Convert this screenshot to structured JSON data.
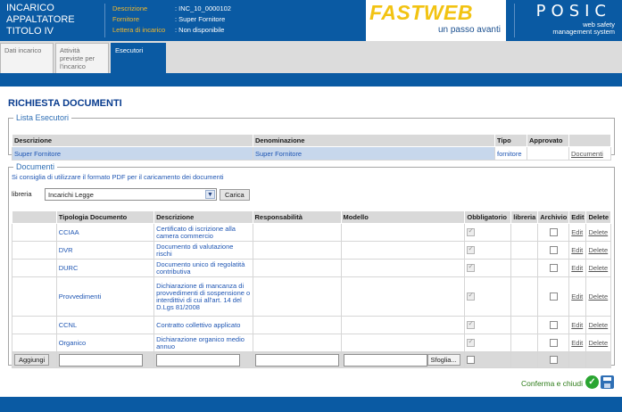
{
  "header": {
    "title": "INCARICO APPALTATORE TITOLO IV",
    "info": [
      {
        "key": "Descrizione",
        "value": ": INC_10_0000102"
      },
      {
        "key": "Fornitore",
        "value": ": Super Fornitore"
      },
      {
        "key": "Lettera di incarico",
        "value": ": Non disponibile"
      }
    ],
    "logo_text": "FASTWEB",
    "logo_sub": "un passo avanti",
    "brand": "POSIC",
    "brand_tag1": "web safety",
    "brand_tag2": "management system"
  },
  "tabs": [
    {
      "label": "Dati incarico",
      "active": false
    },
    {
      "label": "Attività previste per l'incarico",
      "active": false
    },
    {
      "label": "Esecutori",
      "active": true
    }
  ],
  "page_title": "RICHIESTA DOCUMENTI",
  "esecutori": {
    "legend": "Lista Esecutori",
    "headers": [
      "Descrizione",
      "Denominazione",
      "Tipo",
      "Approvato",
      ""
    ],
    "rows": [
      {
        "descrizione": "Super Fornitore",
        "denominazione": "Super Fornitore",
        "tipo": "fornitore",
        "approvato": "",
        "action": "Documenti"
      }
    ]
  },
  "documenti": {
    "legend": "Documenti",
    "hint": "Si consiglia di utilizzare il formato PDF per il caricamento dei documenti",
    "libreria_label": "libreria",
    "libreria_value": "Incarichi Legge",
    "carica_label": "Carica",
    "headers": [
      "",
      "Tipologia Documento",
      "Descrizione",
      "Responsabilità",
      "Modello",
      "Obbligatorio",
      "libreria",
      "Archivio",
      "Edit",
      "Delete"
    ],
    "rows": [
      {
        "tipologia": "CCIAA",
        "descrizione": "Certificato di iscrizione alla camera commercio",
        "obbligatorio": true
      },
      {
        "tipologia": "DVR",
        "descrizione": "Documento di valutazione rischi",
        "obbligatorio": true
      },
      {
        "tipologia": "DURC",
        "descrizione": "Documento unico di regolatità contributiva",
        "obbligatorio": true
      },
      {
        "tipologia": "Provvedimenti",
        "descrizione": "Dichiarazione di mancanza di provvedimenti di sospensione o interdittivi di cui all'art. 14 del D.Lgs 81/2008",
        "obbligatorio": true
      },
      {
        "tipologia": "CCNL",
        "descrizione": "Contratto collettivo applicato",
        "obbligatorio": true
      },
      {
        "tipologia": "Organico",
        "descrizione": "Dichiarazione organico medio annuo",
        "obbligatorio": true
      }
    ],
    "edit_label": "Edit",
    "delete_label": "Delete",
    "add_label": "Aggiungi",
    "browse_label": "Sfoglia..."
  },
  "footer": {
    "confirm_label": "Conferma e chiudi"
  }
}
